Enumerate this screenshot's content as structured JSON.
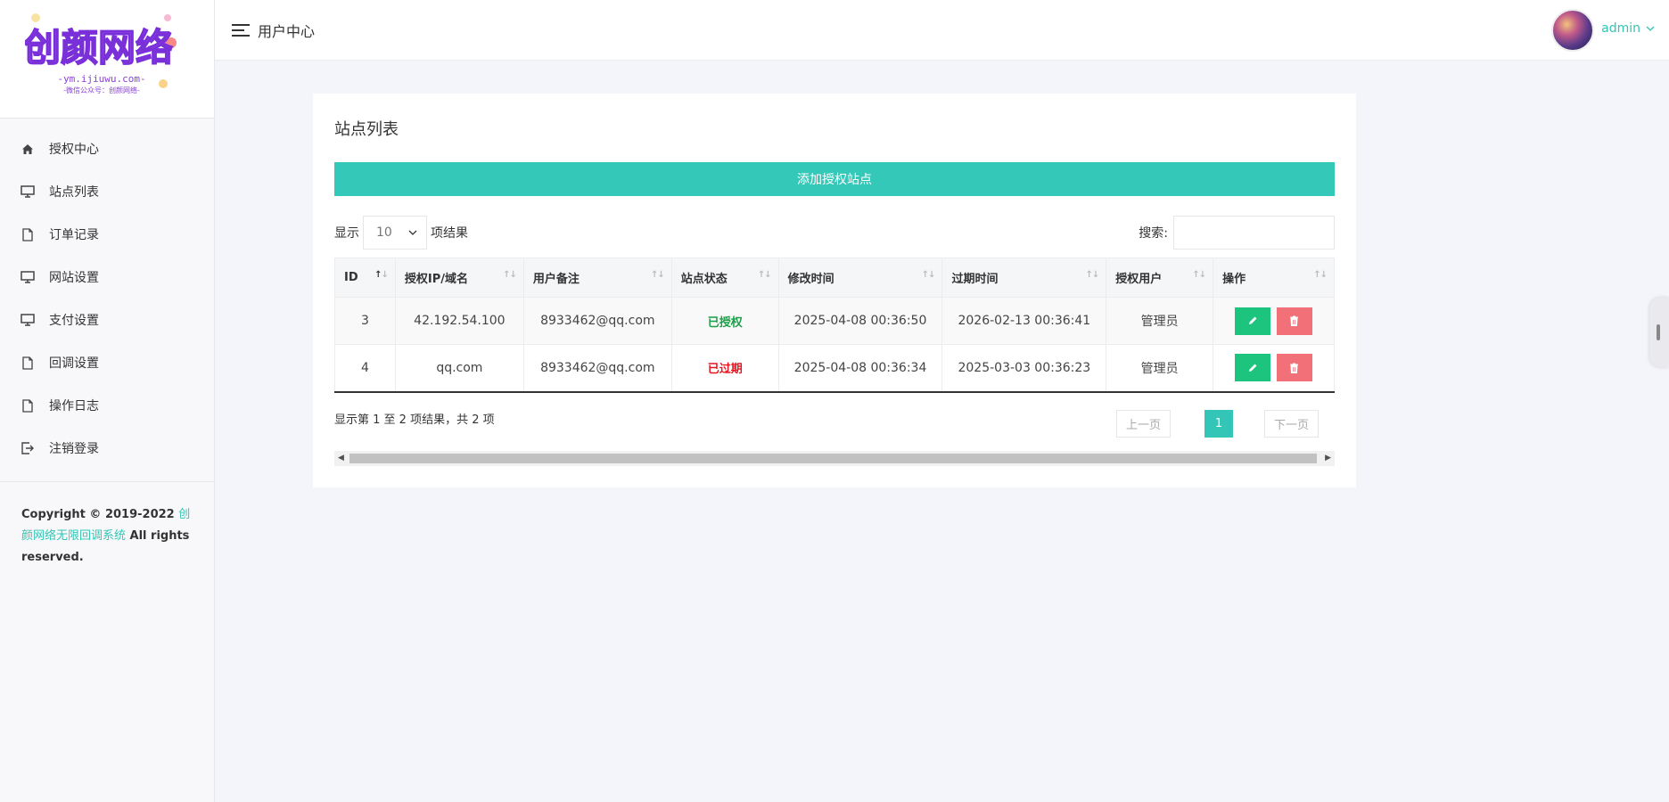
{
  "brand": {
    "logo_text": "创颜网络",
    "logo_sub1": "-ym.ijiuwu.com-",
    "logo_sub2": "-微信公众号：创颜网络-"
  },
  "sidebar": {
    "items": [
      {
        "label": "授权中心",
        "icon": "home-icon"
      },
      {
        "label": "站点列表",
        "icon": "monitor-icon"
      },
      {
        "label": "订单记录",
        "icon": "file-icon"
      },
      {
        "label": "网站设置",
        "icon": "monitor-icon"
      },
      {
        "label": "支付设置",
        "icon": "monitor-icon"
      },
      {
        "label": "回调设置",
        "icon": "file-icon"
      },
      {
        "label": "操作日志",
        "icon": "file-icon"
      },
      {
        "label": "注销登录",
        "icon": "logout-icon"
      }
    ],
    "copyright_prefix": "Copyright © 2019-2022 ",
    "copyright_link": "创颜网络无限回调系统",
    "copyright_suffix": " All rights reserved."
  },
  "header": {
    "title": "用户中心",
    "username": "admin"
  },
  "main": {
    "card_title": "站点列表",
    "add_button": "添加授权站点",
    "length_prefix": "显示",
    "length_value": "10",
    "length_suffix": "项结果",
    "search_label": "搜索:",
    "search_value": "",
    "columns": [
      "ID",
      "授权IP/域名",
      "用户备注",
      "站点状态",
      "修改时间",
      "过期时间",
      "授权用户",
      "操作"
    ],
    "rows": [
      {
        "id": "3",
        "domain": "42.192.54.100",
        "note": "8933462@qq.com",
        "status": "已授权",
        "status_type": "ok",
        "modified": "2025-04-08 00:36:50",
        "expires": "2026-02-13 00:36:41",
        "user": "管理员"
      },
      {
        "id": "4",
        "domain": "qq.com",
        "note": "8933462@qq.com",
        "status": "已过期",
        "status_type": "expired",
        "modified": "2025-04-08 00:36:34",
        "expires": "2025-03-03 00:36:23",
        "user": "管理员"
      }
    ],
    "info_text": "显示第 1 至 2 项结果，共 2 项",
    "pager": {
      "prev": "上一页",
      "current": "1",
      "next": "下一页"
    }
  },
  "colors": {
    "accent": "#33c5b5",
    "edit": "#1dc47e",
    "delete": "#f27077",
    "status_ok": "#1aa047",
    "status_expired": "#e8141e"
  }
}
